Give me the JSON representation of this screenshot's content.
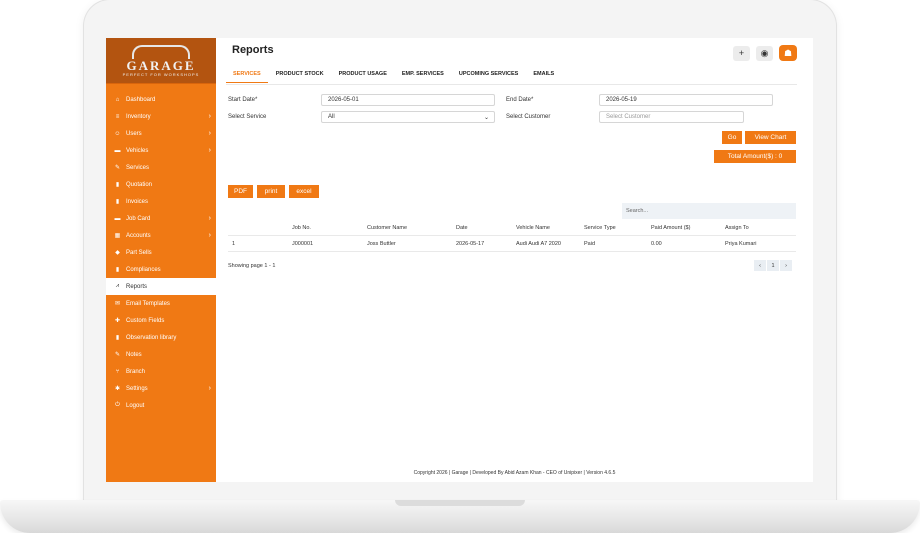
{
  "logo": {
    "word": "GARAGE",
    "sub": "PERFECT FOR WORKSHOPS"
  },
  "sidebar": {
    "items": [
      {
        "label": "Dashboard",
        "icon": "⌂",
        "has_sub": false
      },
      {
        "label": "Inventory",
        "icon": "≡",
        "has_sub": true
      },
      {
        "label": "Users",
        "icon": "☺",
        "has_sub": true
      },
      {
        "label": "Vehicles",
        "icon": "▬",
        "has_sub": true
      },
      {
        "label": "Services",
        "icon": "✎",
        "has_sub": false
      },
      {
        "label": "Quotation",
        "icon": "▮",
        "has_sub": false
      },
      {
        "label": "Invoices",
        "icon": "▮",
        "has_sub": false
      },
      {
        "label": "Job Card",
        "icon": "▬",
        "has_sub": true
      },
      {
        "label": "Accounts",
        "icon": "▦",
        "has_sub": true
      },
      {
        "label": "Part Sells",
        "icon": "◆",
        "has_sub": false
      },
      {
        "label": "Compliances",
        "icon": "▮",
        "has_sub": false
      },
      {
        "label": "Reports",
        "icon": "⩘",
        "has_sub": false
      },
      {
        "label": "Email Templates",
        "icon": "✉",
        "has_sub": false
      },
      {
        "label": "Custom Fields",
        "icon": "✚",
        "has_sub": false
      },
      {
        "label": "Observation library",
        "icon": "▮",
        "has_sub": false
      },
      {
        "label": "Notes",
        "icon": "✎",
        "has_sub": false
      },
      {
        "label": "Branch",
        "icon": "⑂",
        "has_sub": false
      },
      {
        "label": "Settings",
        "icon": "✱",
        "has_sub": true
      },
      {
        "label": "Logout",
        "icon": "⏻",
        "has_sub": false
      }
    ],
    "active_index": 11
  },
  "header": {
    "title": "Reports",
    "add_icon": "+",
    "eye_icon": "◉",
    "user_icon": "☗"
  },
  "tabs": [
    "SERVICES",
    "PRODUCT STOCK",
    "PRODUCT USAGE",
    "EMP. SERVICES",
    "UPCOMING SERVICES",
    "EMAILS"
  ],
  "filters": {
    "start_label": "Start Date*",
    "start_value": "2026-05-01",
    "end_label": "End Date*",
    "end_value": "2026-05-19",
    "service_label": "Select Service",
    "service_value": "All",
    "customer_label": "Select Customer",
    "customer_placeholder": "Select Customer"
  },
  "buttons": {
    "go": "Go",
    "view_chart": "View Chart",
    "total": "Total Amount($) : 0",
    "pdf": "PDF",
    "print": "print",
    "excel": "excel"
  },
  "search_placeholder": "Search...",
  "table": {
    "headers": [
      "",
      "Job No.",
      "Customer Name",
      "Date",
      "Vehicle Name",
      "Service Type",
      "Paid Amount ($)",
      "Assign To"
    ],
    "rows": [
      [
        "1",
        "J000001",
        "Joss Buttler",
        "2026-05-17",
        "Audi Audi A7 2020",
        "Paid",
        "0.00",
        "Priya Kumari"
      ]
    ]
  },
  "showing": "Showing page 1 - 1",
  "pager": [
    "‹",
    "1",
    "›"
  ],
  "footer": "Copyright 2026 | Garage | Developed By Abid Azam Khan - CEO of Unipixer | Version 4.6.5",
  "colors": {
    "accent": "#f07914",
    "logo_bg": "#b35410"
  }
}
